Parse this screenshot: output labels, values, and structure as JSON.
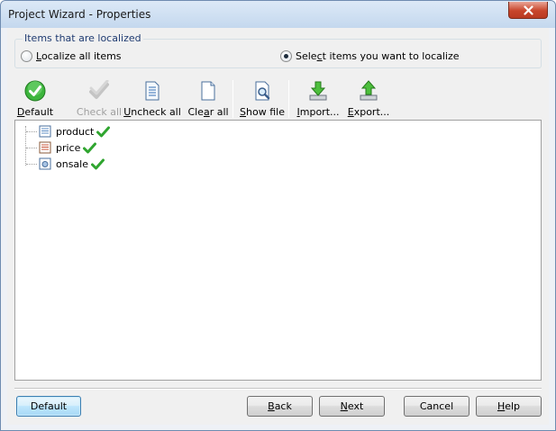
{
  "window": {
    "title": "Project Wizard - Properties"
  },
  "group": {
    "legend": "Items that are localized",
    "options": [
      {
        "label_pre": "",
        "label_mnemonic": "L",
        "label_post": "ocalize all items",
        "selected": false
      },
      {
        "label_pre": "Sele",
        "label_mnemonic": "c",
        "label_post": "t items you want to localize",
        "selected": true
      }
    ]
  },
  "toolbar": {
    "default": {
      "pre": "",
      "mn": "D",
      "post": "efault",
      "icon": "green-check-circle-icon",
      "enabled": true
    },
    "check_all": {
      "label": "Check all",
      "icon": "gray-check-icon",
      "enabled": false
    },
    "uncheck_all": {
      "pre": "",
      "mn": "U",
      "post": "ncheck all",
      "icon": "document-lines-icon",
      "enabled": true
    },
    "clear_all": {
      "pre": "Cle",
      "mn": "a",
      "post": "r all",
      "icon": "blank-document-icon",
      "enabled": true
    },
    "show_file": {
      "pre": "",
      "mn": "S",
      "post": "how file",
      "icon": "magnifier-document-icon",
      "enabled": true
    },
    "import": {
      "pre": "",
      "mn": "I",
      "post": "mport...",
      "icon": "green-down-arrow-icon",
      "enabled": true
    },
    "export": {
      "pre": "",
      "mn": "E",
      "post": "xport...",
      "icon": "green-up-arrow-icon",
      "enabled": true
    }
  },
  "tree": {
    "items": [
      {
        "label": "product",
        "icon": "text-field-icon",
        "checked": true
      },
      {
        "label": "price",
        "icon": "number-field-icon",
        "checked": true
      },
      {
        "label": "onsale",
        "icon": "boolean-field-icon",
        "checked": true
      }
    ]
  },
  "buttons": {
    "default": {
      "label": "Default"
    },
    "back": {
      "pre": "",
      "mn": "B",
      "post": "ack"
    },
    "next": {
      "pre": "",
      "mn": "N",
      "post": "ext"
    },
    "cancel": {
      "label": "Cancel"
    },
    "help": {
      "pre": "",
      "mn": "H",
      "post": "elp"
    }
  },
  "colors": {
    "accent_green": "#2fa52f",
    "group_legend": "#1f3b71",
    "close_red": "#c8452b",
    "focus_blue": "#3c7fb1"
  }
}
